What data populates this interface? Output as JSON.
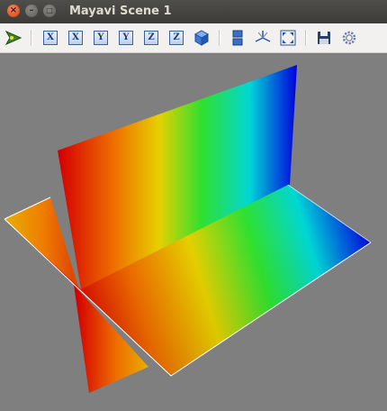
{
  "window": {
    "title": "Mayavi Scene 1",
    "controls": {
      "close_glyph": "×",
      "minimize_glyph": "–",
      "maximize_glyph": "□"
    }
  },
  "toolbar": {
    "buttons": [
      {
        "id": "pipeline",
        "icon": "mayavi-pipeline-icon"
      },
      {
        "id": "view-x-pos",
        "label": "X",
        "icon": "view-x-icon"
      },
      {
        "id": "view-x-neg",
        "label": "X",
        "icon": "view-x-icon"
      },
      {
        "id": "view-y-pos",
        "label": "Y",
        "icon": "view-y-icon"
      },
      {
        "id": "view-y-neg",
        "label": "Y",
        "icon": "view-y-icon"
      },
      {
        "id": "view-z-pos",
        "label": "Z",
        "icon": "view-z-icon"
      },
      {
        "id": "view-z-neg",
        "label": "Z",
        "icon": "view-z-icon"
      },
      {
        "id": "isometric",
        "icon": "isometric-cube-icon"
      },
      {
        "id": "parallel-projection",
        "icon": "parallel-projection-icon"
      },
      {
        "id": "axes",
        "icon": "axes-toggle-icon"
      },
      {
        "id": "full-screen",
        "icon": "full-screen-icon"
      },
      {
        "id": "save",
        "icon": "save-icon"
      },
      {
        "id": "configure",
        "icon": "gear-icon"
      }
    ]
  },
  "scene": {
    "background": "#7f7f7f",
    "colormap": [
      "#d40000",
      "#ee6a00",
      "#e6d000",
      "#2fe02f",
      "#00d6d6",
      "#0000dd"
    ],
    "edge_color": "#ffffff"
  }
}
